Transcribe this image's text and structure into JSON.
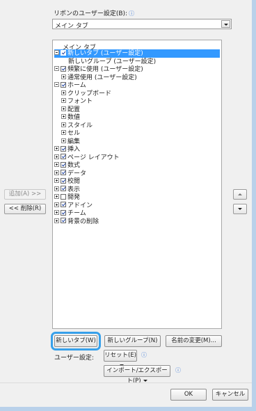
{
  "ribbon_customize": {
    "label": "リボンのユーザー設定(B):",
    "dropdown_value": "メイン タブ"
  },
  "tree": {
    "header": "メイン タブ",
    "rows": [
      {
        "label": "新しいタブ (ユーザー設定)",
        "indent": 0,
        "expander": "minus",
        "checkbox": "checked",
        "selected": true
      },
      {
        "label": "新しいグループ (ユーザー設定)",
        "indent": 2,
        "expander": "none",
        "checkbox": "none",
        "selected": false
      },
      {
        "label": "頻繁に使用 (ユーザー設定)",
        "indent": 0,
        "expander": "minus",
        "checkbox": "checked",
        "selected": false
      },
      {
        "label": "通常使用 (ユーザー設定)",
        "indent": 1,
        "expander": "plus",
        "checkbox": "none",
        "selected": false
      },
      {
        "label": "ホーム",
        "indent": 0,
        "expander": "minus",
        "checkbox": "checked",
        "selected": false
      },
      {
        "label": "クリップボード",
        "indent": 1,
        "expander": "plus",
        "checkbox": "none",
        "selected": false
      },
      {
        "label": "フォント",
        "indent": 1,
        "expander": "plus",
        "checkbox": "none",
        "selected": false
      },
      {
        "label": "配置",
        "indent": 1,
        "expander": "plus",
        "checkbox": "none",
        "selected": false
      },
      {
        "label": "数値",
        "indent": 1,
        "expander": "plus",
        "checkbox": "none",
        "selected": false
      },
      {
        "label": "スタイル",
        "indent": 1,
        "expander": "plus",
        "checkbox": "none",
        "selected": false
      },
      {
        "label": "セル",
        "indent": 1,
        "expander": "plus",
        "checkbox": "none",
        "selected": false
      },
      {
        "label": "編集",
        "indent": 1,
        "expander": "plus",
        "checkbox": "none",
        "selected": false
      },
      {
        "label": "挿入",
        "indent": 0,
        "expander": "plus",
        "checkbox": "checked",
        "selected": false
      },
      {
        "label": "ページ レイアウト",
        "indent": 0,
        "expander": "plus",
        "checkbox": "checked",
        "selected": false
      },
      {
        "label": "数式",
        "indent": 0,
        "expander": "plus",
        "checkbox": "checked",
        "selected": false
      },
      {
        "label": "データ",
        "indent": 0,
        "expander": "plus",
        "checkbox": "checked",
        "selected": false
      },
      {
        "label": "校閲",
        "indent": 0,
        "expander": "plus",
        "checkbox": "checked",
        "selected": false
      },
      {
        "label": "表示",
        "indent": 0,
        "expander": "plus",
        "checkbox": "checked",
        "selected": false
      },
      {
        "label": "開発",
        "indent": 0,
        "expander": "plus",
        "checkbox": "unchecked",
        "selected": false
      },
      {
        "label": "アドイン",
        "indent": 0,
        "expander": "plus",
        "checkbox": "checked",
        "selected": false
      },
      {
        "label": "チーム",
        "indent": 0,
        "expander": "plus",
        "checkbox": "checked",
        "selected": false
      },
      {
        "label": "背景の削除",
        "indent": 0,
        "expander": "plus",
        "checkbox": "checked",
        "selected": false
      }
    ]
  },
  "side_buttons": {
    "add": "追加(A) >>",
    "remove": "<< 削除(R)"
  },
  "actions": {
    "new_tab": "新しいタブ(W)",
    "new_group": "新しいグループ(N)",
    "rename": "名前の変更(M)..."
  },
  "customizations": {
    "label": "ユーザー設定:",
    "reset": "リセット(E)",
    "import_export": "インポート/エクスポート(P)"
  },
  "dialog": {
    "ok": "OK",
    "cancel": "キャンセル"
  },
  "colors": {
    "selection": "#3399ff",
    "focus_ring": "#37a0ea",
    "info": "#3b78d8"
  }
}
